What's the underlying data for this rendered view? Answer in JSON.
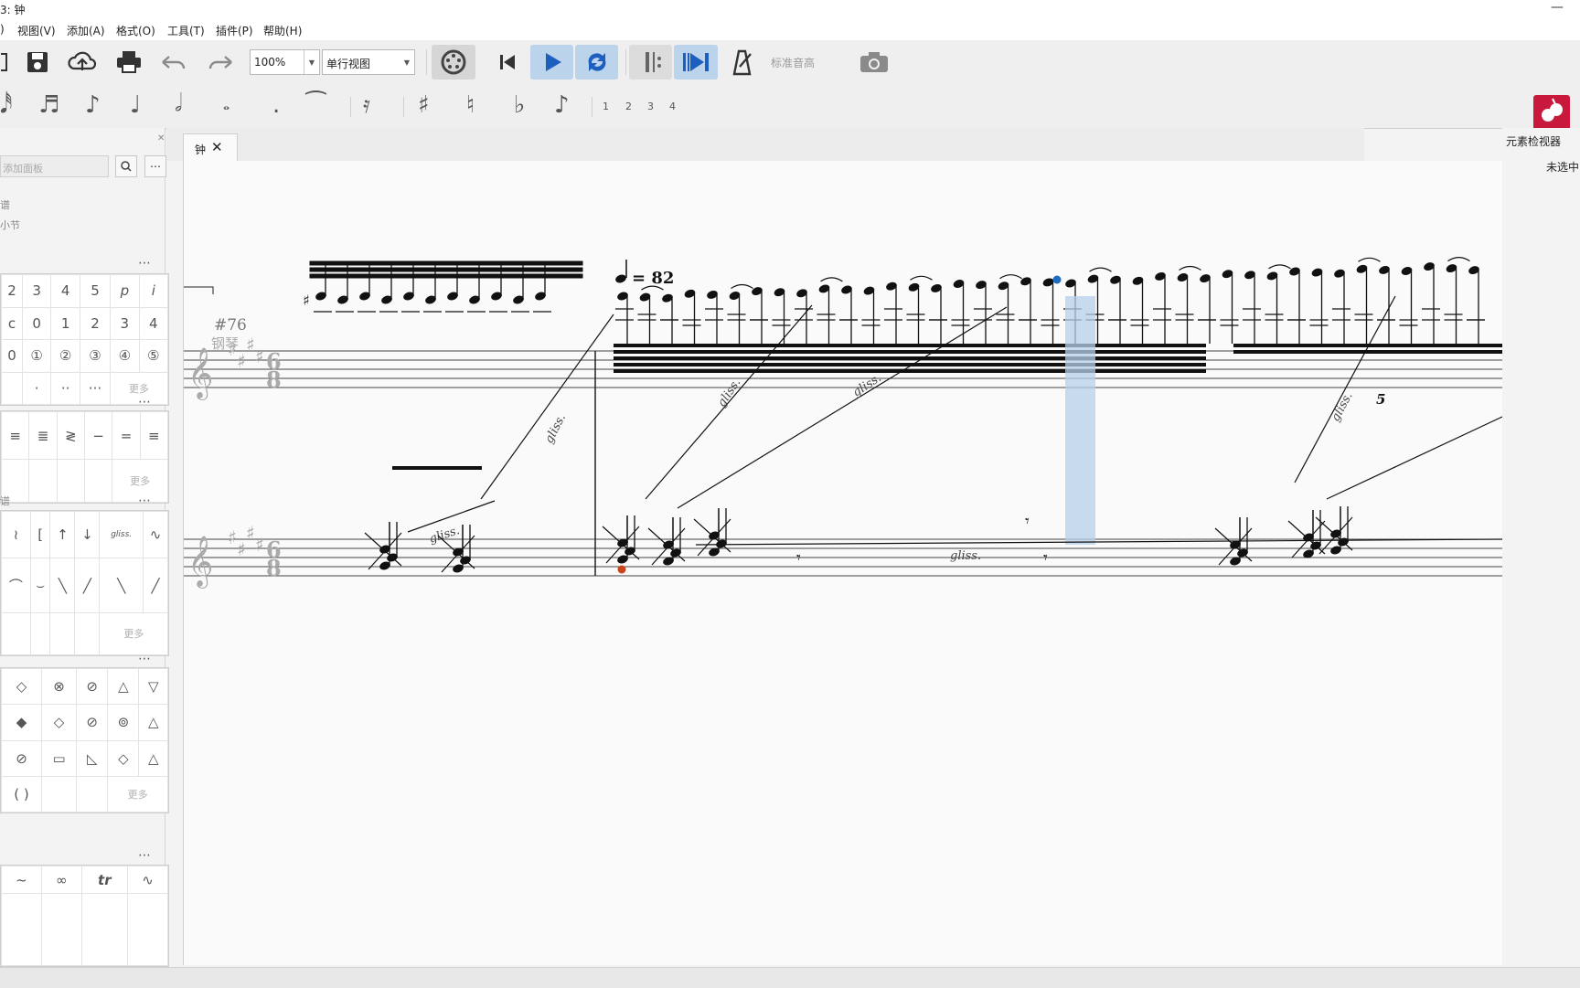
{
  "window": {
    "title": "3: 钟",
    "minimize": "—"
  },
  "menu": [
    "视图(V)",
    "添加(A)",
    "格式(O)",
    "工具(T)",
    "插件(P)",
    "帮助(H)"
  ],
  "menu_partial_left": ")",
  "toolbar": {
    "zoom_value": "100%",
    "view_mode": "单行视图",
    "concert_pitch": "标准音高",
    "icons": [
      "new-icon",
      "save-icon",
      "cloud-upload-icon",
      "print-icon",
      "undo-icon",
      "redo-icon",
      "mixer-icon",
      "rewind-icon",
      "play-icon",
      "loop-icon",
      "loop-in-out-icon",
      "playback-to-end-icon",
      "metronome-icon",
      "screenshot-icon"
    ]
  },
  "note_input": {
    "voices": [
      "1",
      "2",
      "3",
      "4"
    ],
    "icons": [
      "64th-note-icon",
      "16th-note-icon",
      "8th-note-icon",
      "quarter-note-icon",
      "half-note-icon",
      "whole-note-icon",
      "dot-icon",
      "tie-icon",
      "rest-icon",
      "sharp-icon",
      "natural-icon",
      "flat-icon",
      "flip-direction-icon"
    ]
  },
  "palette": {
    "search_placeholder": "添加面板",
    "labels": [
      "谱",
      "小节"
    ],
    "section_dots": "⋯",
    "fingering_rows": [
      [
        "2",
        "3",
        "4",
        "5",
        "p",
        "i"
      ],
      [
        "c",
        "0",
        "1",
        "2",
        "3",
        "4"
      ],
      [
        "0",
        "①",
        "②",
        "③",
        "④",
        "⑤"
      ],
      [
        "",
        "·",
        "··",
        "···",
        "更多",
        ""
      ]
    ],
    "tremolo_row": [
      "≡",
      "≣",
      "≷",
      "−",
      "=",
      "≡"
    ],
    "arpeggio_row1": [
      "≀",
      "[",
      "↑",
      "↓",
      "gliss.",
      "∿"
    ],
    "arpeggio_row2": [
      "⌒",
      "⌣",
      "╲",
      "╱",
      "╲",
      "╱"
    ],
    "noteheads_row1": [
      "◇",
      "⊗",
      "⊘",
      "△",
      "▽"
    ],
    "noteheads_row2": [
      "◆",
      "◇",
      "⊘",
      "⊚",
      "△"
    ],
    "noteheads_row3": [
      "⊘",
      "▭",
      "◺",
      "◇",
      "△"
    ],
    "noteheads_row4": [
      "( )",
      "",
      "",
      "更多"
    ],
    "ornaments_row": [
      "~",
      "∞",
      "tr",
      "∿"
    ],
    "more_label": "更多",
    "section_label_partial": "谱"
  },
  "tab": {
    "label": "钟",
    "close": "✕"
  },
  "score": {
    "measure_number": "#76",
    "instrument_label": "钢琴",
    "tempo_text": "= 82",
    "time_signature": [
      "6",
      "8"
    ],
    "tuplet": "5",
    "gliss_labels": [
      "gliss.",
      "gliss.",
      "gliss.",
      "gliss.",
      "gliss.",
      "gliss."
    ]
  },
  "inspector": {
    "title": "元素检视器",
    "status": "未选中"
  }
}
